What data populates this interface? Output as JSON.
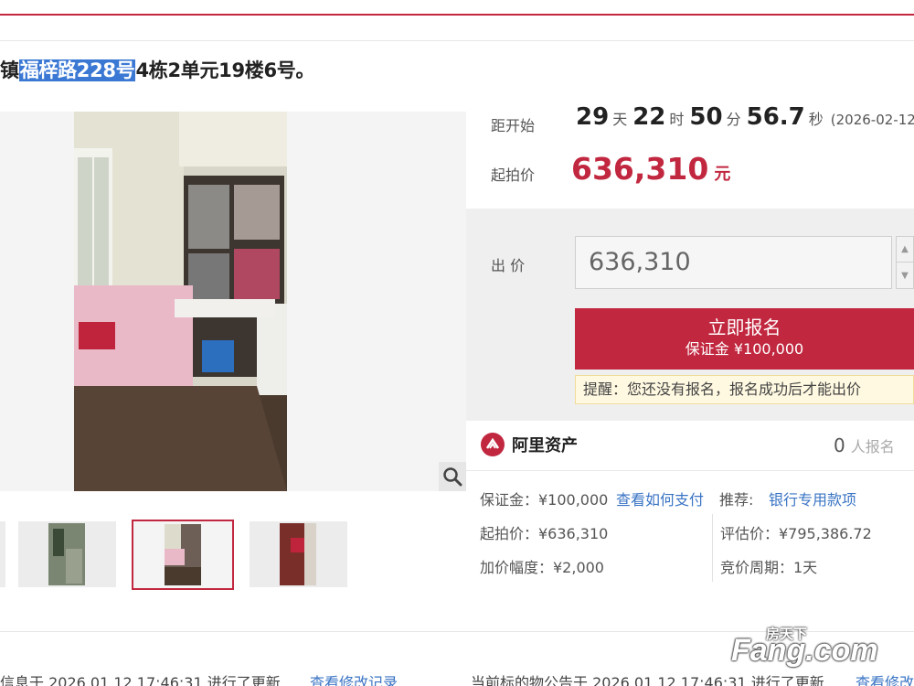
{
  "title": {
    "prefix": "镇",
    "highlight": "福梓路228号",
    "suffix": "4栋2单元19楼6号。"
  },
  "countdown": {
    "label": "距开始",
    "days": "29",
    "days_unit": "天",
    "hours": "22",
    "hours_unit": "时",
    "minutes": "50",
    "minutes_unit": "分",
    "seconds": "56.7",
    "seconds_unit": "秒",
    "date": "(2026-02-12"
  },
  "starting_price": {
    "label": "起拍价",
    "value": "636,310",
    "unit": "元"
  },
  "bid": {
    "label": "出 价",
    "input_value": "636,310",
    "signup_label": "立即报名",
    "deposit_label": "保证金 ¥100,000",
    "reminder": "提醒：您还没有报名，报名成功后才能出价"
  },
  "provider": {
    "name": "阿里资产",
    "signup_count": "0",
    "signup_unit": "人报名"
  },
  "details": {
    "deposit": "保证金：¥100,000",
    "how_to_pay": "查看如何支付",
    "recommend_label": "推荐:",
    "recommend_link": "银行专用款项",
    "start_price": "起拍价：¥636,310",
    "appraisal": "评估价：¥795,386.72",
    "increment": "加价幅度：¥2,000",
    "cycle": "竞价周期：1天"
  },
  "footer": {
    "left_text": "信息于 2026.01.12 17:46:31 进行了更新",
    "left_link": "查看修改记录",
    "right_text": "当前标的物公告于 2026.01.12 17:46:31 进行了更新",
    "right_link": "查看修改"
  },
  "watermark": {
    "brand_top": "房天下",
    "brand": "Fang.com"
  },
  "colors": {
    "accent": "#c1273f",
    "link": "#3a74c4",
    "highlight": "#3a78d4"
  }
}
